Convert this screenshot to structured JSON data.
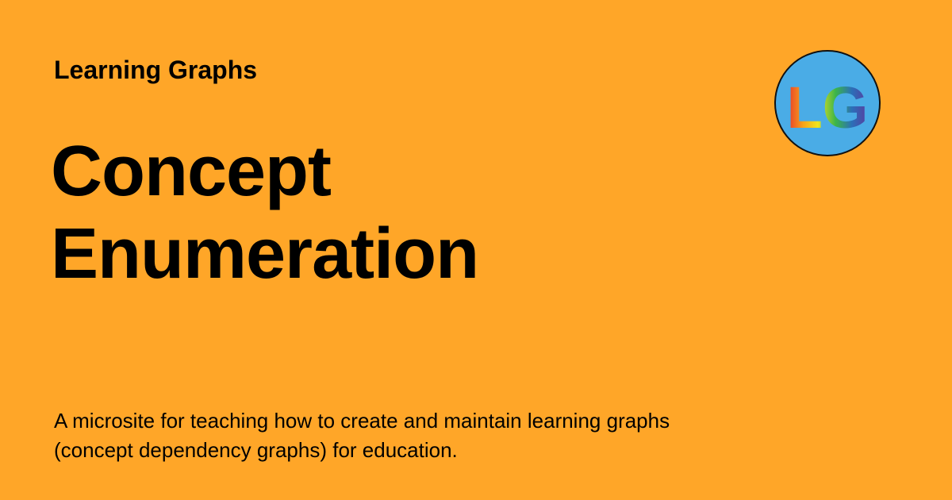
{
  "site": {
    "name": "Learning Graphs"
  },
  "page": {
    "title_line1": "Concept",
    "title_line2": "Enumeration",
    "description": "A microsite for teaching how to create and maintain learning graphs (concept dependency graphs) for education."
  },
  "logo": {
    "text": "LG",
    "background": "#4AACE6",
    "gradient": [
      "#E8342A",
      "#F7A21B",
      "#F2E41C",
      "#3BB54A",
      "#2B6FB8",
      "#5B3B9E"
    ]
  },
  "colors": {
    "background": "#FFA628",
    "text": "#000000"
  }
}
